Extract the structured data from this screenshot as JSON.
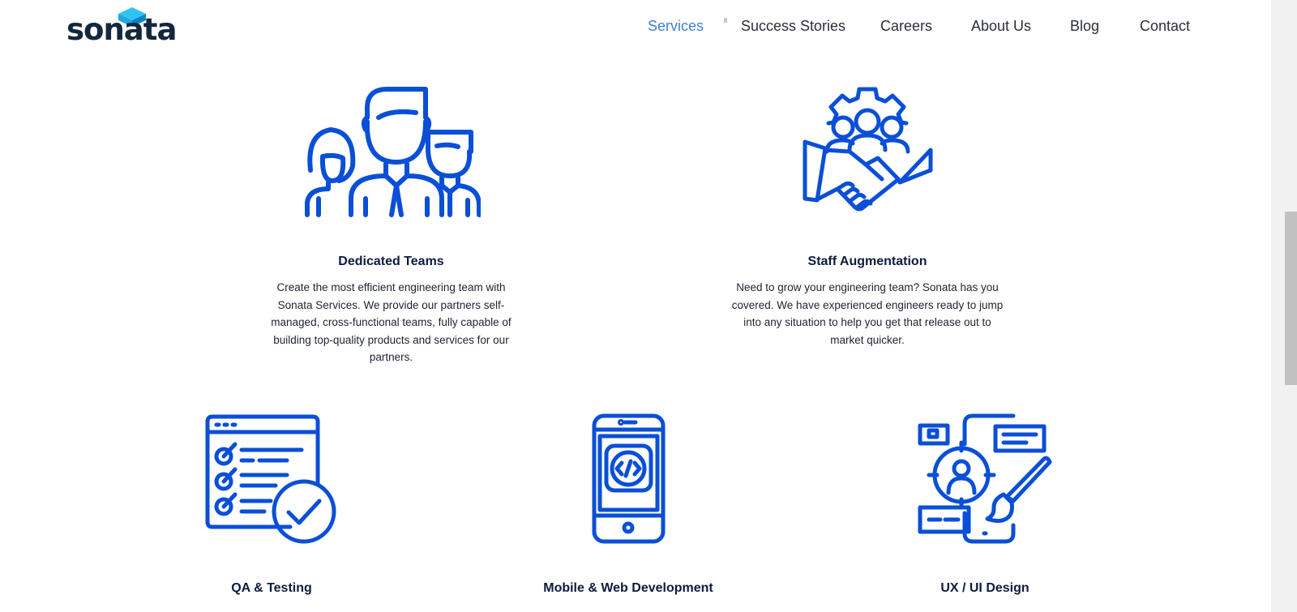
{
  "brand": {
    "name": "sonata",
    "accent_color": "#0a4fd6",
    "mark_color": "#2ec4f0"
  },
  "nav": {
    "items": [
      {
        "label": "Services",
        "active": true
      },
      {
        "label": "Success Stories",
        "active": false
      },
      {
        "label": "Careers",
        "active": false
      },
      {
        "label": "About Us",
        "active": false
      },
      {
        "label": "Blog",
        "active": false
      },
      {
        "label": "Contact",
        "active": false
      }
    ]
  },
  "services": [
    {
      "icon": "team-people-icon",
      "title": "Dedicated Teams",
      "description": "Create the most efficient engineering team with Sonata Services. We provide our partners self-managed, cross-functional teams, fully capable of building top-quality products and services for our partners."
    },
    {
      "icon": "handshake-gear-icon",
      "title": "Staff Augmentation",
      "description": "Need to grow your engineering team? Sonata has you covered. We have experienced engineers ready to jump into any situation to help you get that release out to market quicker."
    },
    {
      "icon": "checklist-icon",
      "title": "QA & Testing"
    },
    {
      "icon": "mobile-code-icon",
      "title": "Mobile & Web Development"
    },
    {
      "icon": "design-tools-icon",
      "title": "UX / UI Design"
    }
  ]
}
